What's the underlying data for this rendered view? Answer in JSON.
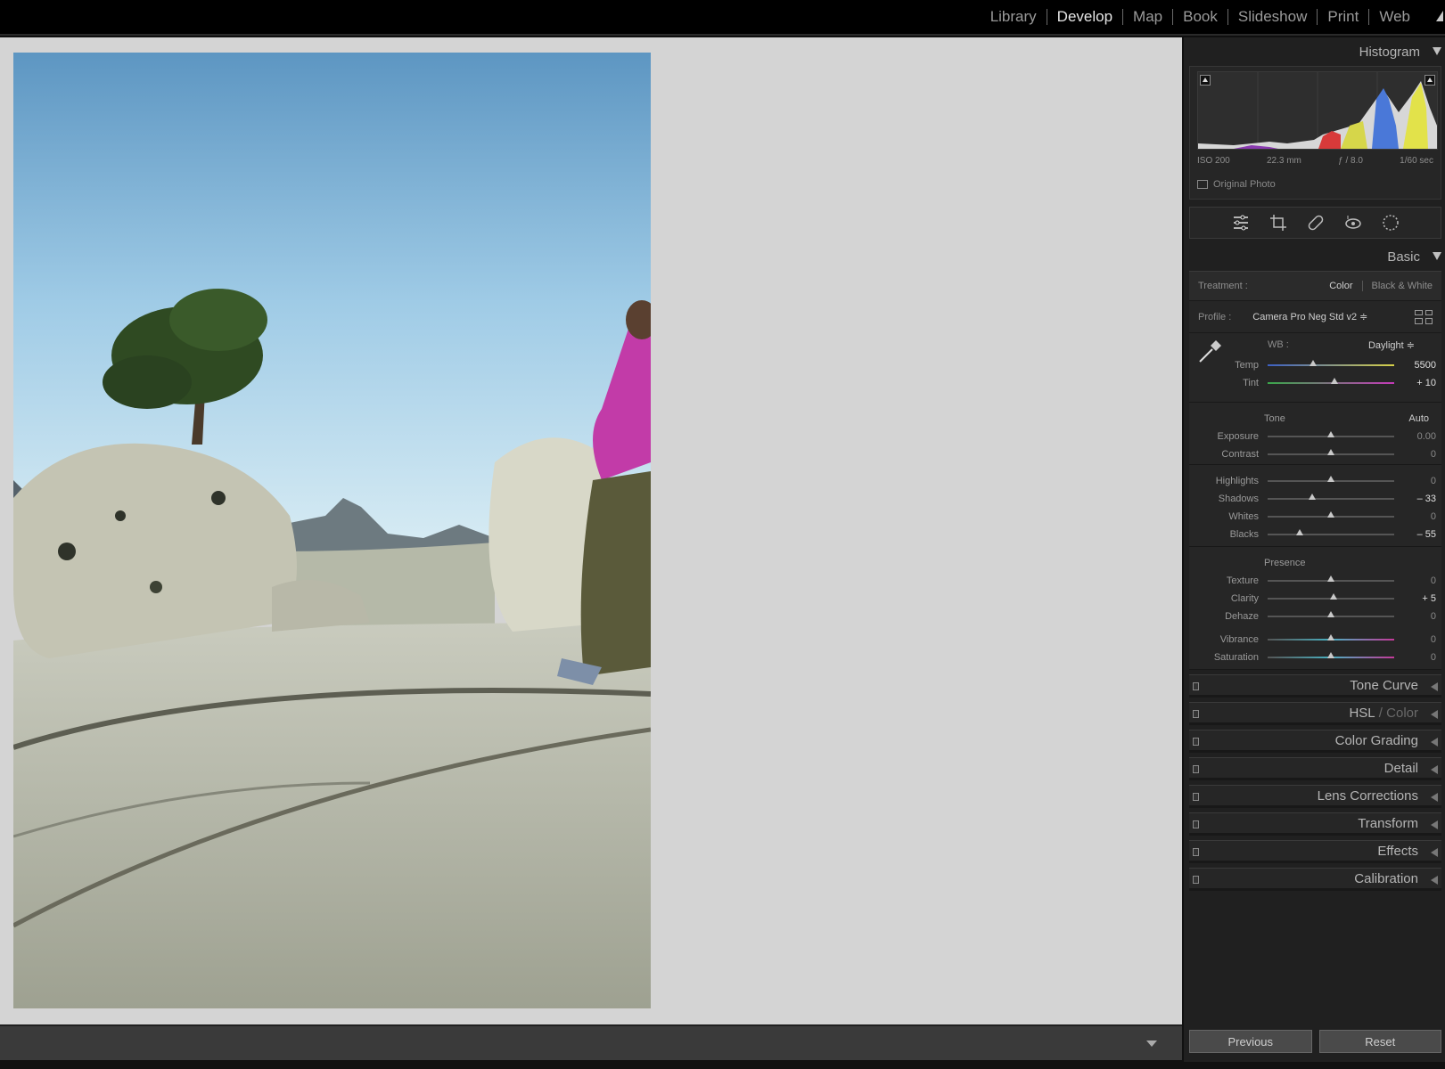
{
  "modules": [
    "Library",
    "Develop",
    "Map",
    "Book",
    "Slideshow",
    "Print",
    "Web"
  ],
  "active_module": "Develop",
  "histogram": {
    "title": "Histogram",
    "iso": "ISO 200",
    "focal": "22.3 mm",
    "aperture": "ƒ / 8.0",
    "shutter": "1/60 sec",
    "original_photo": "Original Photo"
  },
  "basic": {
    "title": "Basic",
    "treatment_label": "Treatment :",
    "treatment_color": "Color",
    "treatment_bw": "Black & White",
    "profile_label": "Profile :",
    "profile_value": "Camera Pro Neg Std v2 ≑",
    "wb_label": "WB :",
    "wb_value": "Daylight ≑",
    "tone_label": "Tone",
    "auto_label": "Auto",
    "presence_label": "Presence",
    "sliders": {
      "temp": {
        "name": "Temp",
        "value": "5500",
        "level": 0.36
      },
      "tint": {
        "name": "Tint",
        "value": "+ 10",
        "level": 0.53
      },
      "exposure": {
        "name": "Exposure",
        "value": "0.00",
        "level": 0.5
      },
      "contrast": {
        "name": "Contrast",
        "value": "0",
        "level": 0.5
      },
      "highlights": {
        "name": "Highlights",
        "value": "0",
        "level": 0.5
      },
      "shadows": {
        "name": "Shadows",
        "value": "– 33",
        "level": 0.35
      },
      "whites": {
        "name": "Whites",
        "value": "0",
        "level": 0.5
      },
      "blacks": {
        "name": "Blacks",
        "value": "– 55",
        "level": 0.25
      },
      "texture": {
        "name": "Texture",
        "value": "0",
        "level": 0.5
      },
      "clarity": {
        "name": "Clarity",
        "value": "+ 5",
        "level": 0.52
      },
      "dehaze": {
        "name": "Dehaze",
        "value": "0",
        "level": 0.5
      },
      "vibrance": {
        "name": "Vibrance",
        "value": "0",
        "level": 0.5
      },
      "saturation": {
        "name": "Saturation",
        "value": "0",
        "level": 0.5
      }
    }
  },
  "panels": {
    "tone_curve": "Tone Curve",
    "hsl": "HSL",
    "hsl_sep": " / ",
    "color": "Color",
    "color_grading": "Color Grading",
    "detail": "Detail",
    "lens": "Lens Corrections",
    "transform": "Transform",
    "effects": "Effects",
    "calibration": "Calibration"
  },
  "buttons": {
    "previous": "Previous",
    "reset": "Reset"
  },
  "colors": {
    "canvas": "#d4d4d4",
    "panel": "#262626"
  }
}
